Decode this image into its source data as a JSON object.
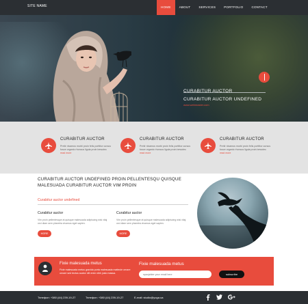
{
  "header": {
    "site_name": "SITE NAME",
    "nav": [
      {
        "label": "HOME",
        "active": true
      },
      {
        "label": "ABOUT",
        "active": false
      },
      {
        "label": "SERVICES",
        "active": false
      },
      {
        "label": "PORTFOLIO",
        "active": false
      },
      {
        "label": "CONTACT",
        "active": false
      }
    ]
  },
  "hero": {
    "title": "CURABITUR AUCTOR",
    "subtitle": "CURABITUR AUCTOR UNDEFINED",
    "link": "www.webmaster.com"
  },
  "features": [
    {
      "title": "CURABITUR AUCTOR",
      "text": "Pretir nivamus morbi proin felis porttitor cursus fusce organic rhoncus ligula proin bewotec",
      "more": "read more",
      "icon": "airplane-icon"
    },
    {
      "title": "CURABITUR AUCTOR",
      "text": "Pretir nivamus morbi proin felis porttitor cursus fusce organic rhoncus ligula proin bewotec",
      "more": "read more",
      "icon": "airplane-icon"
    },
    {
      "title": "CURABITUR AUCTOR",
      "text": "Pretir nivamus morbi proin felis porttitor cursus fusce organic rhoncus ligula proin bewotec",
      "more": "read more",
      "icon": "airplane-icon"
    }
  ],
  "main": {
    "headline": "CURABITUR AUCTOR UNDEFINED PROIN PELLENTESQU QUISQUE MALESUADA CURABITUR AUCTOR VIM PROIN",
    "red_title": "Curabitur auctor undefined",
    "columns": [
      {
        "title": "Curabitur auctor",
        "text": "Vim proin pellentesque at quisque malesuada adipiscing wisi vitaj orci diam sem pharetra vivamus eget sapien.",
        "button": "MORE"
      },
      {
        "title": "Curabitur auctor",
        "text": "Vim proin pellentesque at quisque malesuada adipiscing wisi vitaj orci diam sem pharetra vivamus eget sapien.",
        "button": "MORE"
      }
    ]
  },
  "subscribe": {
    "left_title": "Fixie malesuada metus",
    "left_text": "Fixie malesuada metus gravida porta malesuada mattecle ornare ornare sed tectus auctor elit enim nibh justo massa.",
    "right_title": "Fixie malesuada metus",
    "placeholder": "приоjekter your email here",
    "button": "subscribe"
  },
  "footer": {
    "phone1": "Телефон: +380 (44) 239-19-27",
    "phone2": "Телефон: +380 (44) 239-19-27",
    "email": "E-mail: studio@yoga.ua",
    "social": [
      "facebook-icon",
      "twitter-icon",
      "google-plus-icon"
    ]
  },
  "colors": {
    "accent": "#e84c3d",
    "dark": "#2b2f33",
    "band": "#e3e3e3"
  }
}
